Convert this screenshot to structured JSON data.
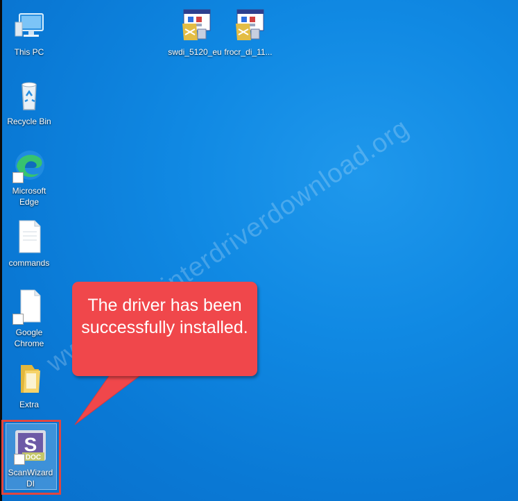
{
  "desktop_icons": {
    "this_pc": "This PC",
    "recycle_bin": "Recycle Bin",
    "edge": "Microsoft\nEdge",
    "commands": "commands",
    "chrome": "Google\nChrome",
    "extra": "Extra",
    "scanwizard": "ScanWizard\nDI",
    "swdi": "swdi_5120_eu",
    "frocr": "frocr_di_11..."
  },
  "callout": {
    "text": "The driver has been successfully installed."
  },
  "watermark": "www.freeprinterdriverdownload.org",
  "icon_names": [
    "computer-icon",
    "recycle-bin-icon",
    "edge-icon",
    "document-icon",
    "chrome-shortcut-icon",
    "folder-icon",
    "scanwizard-icon",
    "installer-icon"
  ],
  "colors": {
    "desktop_bg": "#0a7ad6",
    "callout_bg": "#f0474b",
    "highlight_border": "#e2463f"
  }
}
